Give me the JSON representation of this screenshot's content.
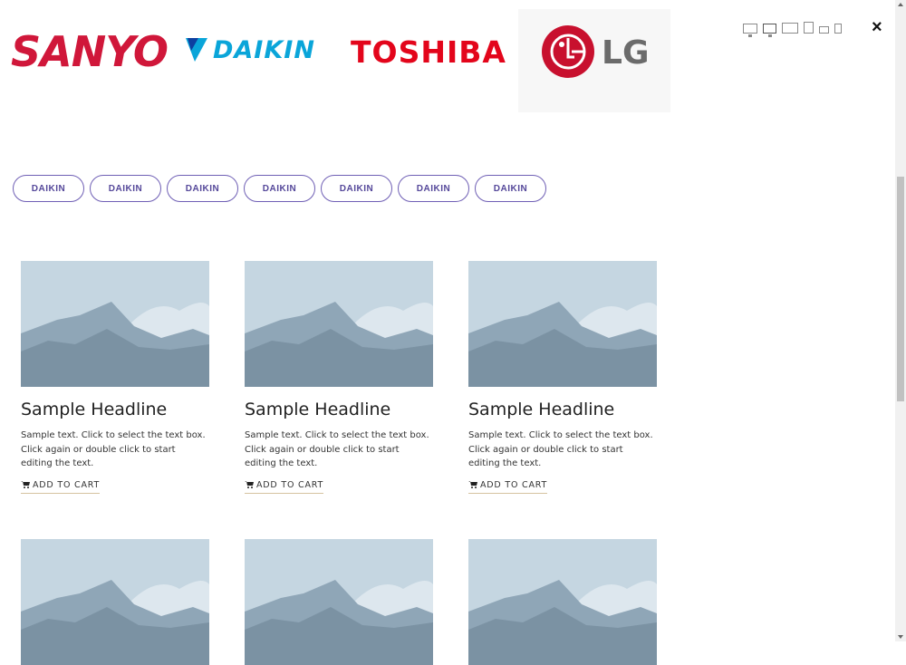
{
  "brands": {
    "sanyo": "SANYO",
    "daikin": "DAIKIN",
    "toshiba": "TOSHIBA",
    "lg": "LG"
  },
  "device_toolbar": {
    "icons": [
      "desktop-icon",
      "desktop-icon",
      "laptop-icon",
      "tablet-icon",
      "phone-landscape-icon",
      "phone-portrait-icon"
    ],
    "close_icon": "close-icon",
    "close_label": "×"
  },
  "filters": [
    "DAIKIN",
    "DAIKIN",
    "DAIKIN",
    "DAIKIN",
    "DAIKIN",
    "DAIKIN",
    "DAIKIN"
  ],
  "products": [
    {
      "title": "Sample Headline",
      "text": "Sample text. Click to select the text box. Click again or double click to start editing the text.",
      "cart_label": "ADD TO CART"
    },
    {
      "title": "Sample Headline",
      "text": "Sample text. Click to select the text box. Click again or double click to start editing the text.",
      "cart_label": "ADD TO CART"
    },
    {
      "title": "Sample Headline",
      "text": "Sample text. Click to select the text box. Click again or double click to start editing the text.",
      "cart_label": "ADD TO CART"
    },
    {
      "title": "",
      "text": "",
      "cart_label": ""
    },
    {
      "title": "",
      "text": "",
      "cart_label": ""
    },
    {
      "title": "",
      "text": "",
      "cart_label": ""
    }
  ],
  "colors": {
    "sanyo_red": "#d0173a",
    "daikin_blue": "#0aa5d9",
    "toshiba_red": "#e3051b",
    "lg_red": "#c8102e",
    "pill_border": "#6f5fb5",
    "cart_underline": "#d6c2a0"
  }
}
